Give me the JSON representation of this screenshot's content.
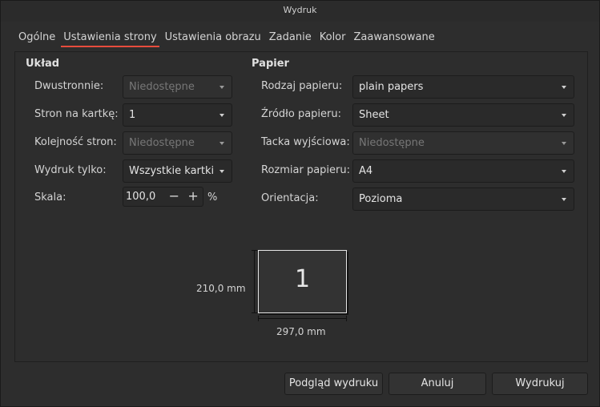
{
  "window": {
    "title": "Wydruk"
  },
  "tabs": [
    {
      "label": "Ogólne"
    },
    {
      "label": "Ustawienia strony"
    },
    {
      "label": "Ustawienia obrazu"
    },
    {
      "label": "Zadanie"
    },
    {
      "label": "Kolor"
    },
    {
      "label": "Zaawansowane"
    }
  ],
  "active_tab": "Ustawienia strony",
  "layout": {
    "title": "Układ",
    "duplex": {
      "label": "Dwustronnie:",
      "value": "Niedostępne",
      "disabled": true
    },
    "pages_per_sheet": {
      "label": "Stron na kartkę:",
      "value": "1"
    },
    "page_order": {
      "label": "Kolejność stron:",
      "value": "Niedostępne",
      "disabled": true
    },
    "print_only": {
      "label": "Wydruk tylko:",
      "value": "Wszystkie kartki"
    },
    "scale": {
      "label": "Skala:",
      "value": "100,0",
      "minus": "−",
      "plus": "+",
      "unit": "%"
    }
  },
  "paper": {
    "title": "Papier",
    "paper_type": {
      "label": "Rodzaj papieru:",
      "value": "plain papers"
    },
    "paper_source": {
      "label": "Źródło papieru:",
      "value": "Sheet"
    },
    "output_tray": {
      "label": "Tacka wyjściowa:",
      "value": "Niedostępne",
      "disabled": true
    },
    "paper_size": {
      "label": "Rozmiar papieru:",
      "value": "A4"
    },
    "orientation": {
      "label": "Orientacja:",
      "value": "Pozioma"
    }
  },
  "preview": {
    "page_number": "1",
    "height_label": "210,0 mm",
    "width_label": "297,0 mm"
  },
  "buttons": {
    "preview": "Podgląd wydruku",
    "cancel": "Anuluj",
    "print": "Wydrukuj"
  },
  "colors": {
    "accent": "#e74c3c",
    "background": "#2d2d2d"
  }
}
